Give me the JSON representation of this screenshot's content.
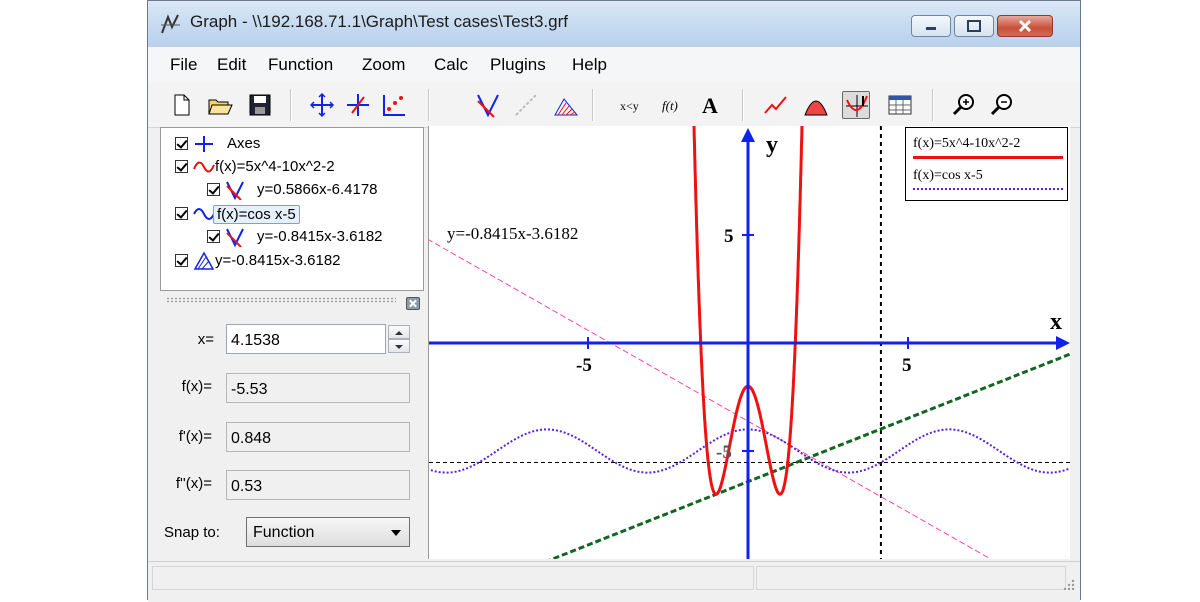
{
  "window": {
    "title": "Graph - \\\\192.168.71.1\\Graph\\Test cases\\Test3.grf"
  },
  "menu": [
    "File",
    "Edit",
    "Function",
    "Zoom",
    "Calc",
    "Plugins",
    "Help"
  ],
  "tree": {
    "items": [
      {
        "label": "Axes",
        "checked": true
      },
      {
        "label": "f(x)=5x^4-10x^2-2",
        "checked": true
      },
      {
        "label": "y=0.5866x-6.4178",
        "checked": true
      },
      {
        "label": "f(x)=cos x-5",
        "checked": true,
        "selected": true
      },
      {
        "label": "y=-0.8415x-3.6182",
        "checked": true
      },
      {
        "label": "y=-0.8415x-3.6182",
        "checked": true
      }
    ]
  },
  "eval": {
    "x_label": "x=",
    "x_value": "4.1538",
    "f_label": "f(x)=",
    "f_value": "-5.53",
    "f1_label": "f'(x)=",
    "f1_value": "0.848",
    "f2_label": "f''(x)=",
    "f2_value": "0.53",
    "snap_label": "Snap to:",
    "snap_value": "Function"
  },
  "graph": {
    "axis_x_label": "x",
    "axis_y_label": "y",
    "tick_neg5": "-5",
    "tick_pos5": "5",
    "tick_y5": "5",
    "tick_yneg5": "-5",
    "annotation": "y=-0.8415x-3.6182"
  },
  "legend": {
    "entry1": "f(x)=5x^4-10x^2-2",
    "entry2": "f(x)=cos x-5"
  },
  "colors": {
    "f1": "#ee1111",
    "f2": "#5522dd",
    "tangent1": "#116622",
    "tangent2": "#ff44aa",
    "axes": "#1122ee"
  }
}
